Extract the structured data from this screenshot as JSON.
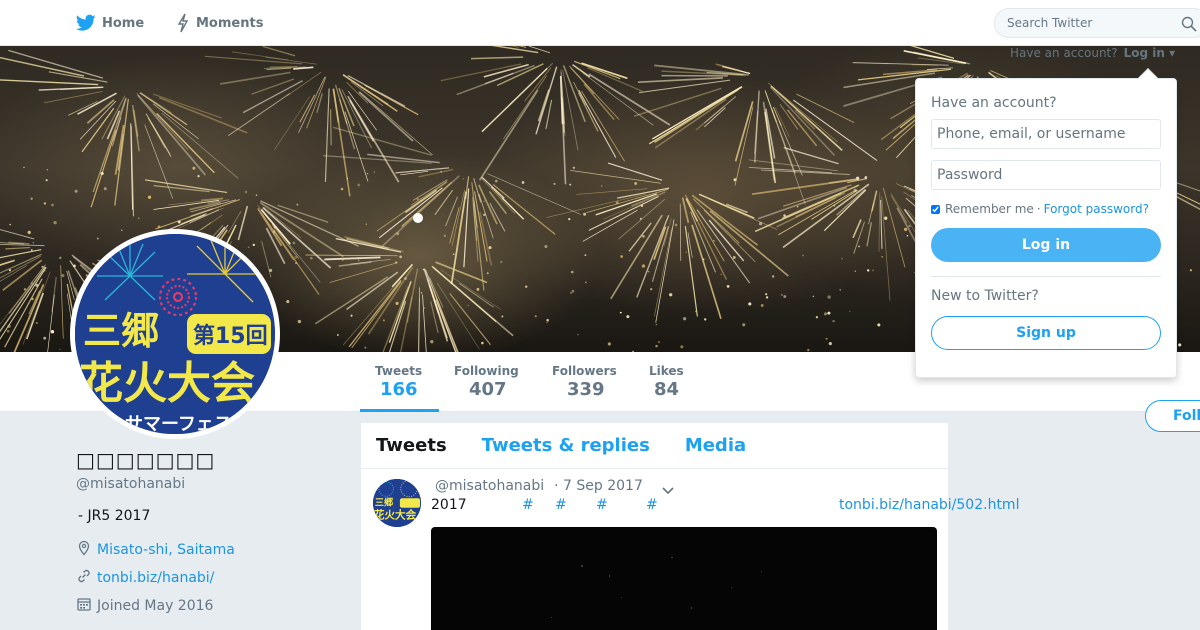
{
  "nav": {
    "home_label": "Home",
    "moments_label": "Moments",
    "search_placeholder": "Search Twitter"
  },
  "header_account": {
    "prompt": "Have an account?",
    "login_label": "Log in"
  },
  "stats": {
    "tweets_label": "Tweets",
    "tweets_value": "166",
    "following_label": "Following",
    "following_value": "407",
    "followers_label": "Followers",
    "followers_value": "339",
    "likes_label": "Likes",
    "likes_value": "84"
  },
  "follow_button_label": "Follow",
  "profile": {
    "name": "□□□□□□□",
    "handle": "@misatohanabi",
    "bio": "- JR5 2017",
    "location": "Misato-shi, Saitama",
    "url": "tonbi.biz/hanabi/",
    "joined": "Joined May 2016"
  },
  "avatar_art": {
    "line1": "三郷",
    "badge": "第15回",
    "line2": "花火大会",
    "line3": "サマーフェスティ"
  },
  "timeline": {
    "tabs": [
      "Tweets",
      "Tweets & replies",
      "Media"
    ],
    "tweet": {
      "handle": "@misatohanabi",
      "date": "· 7 Sep 2017",
      "text_year": "2017",
      "hashtags": [
        "#",
        "#",
        "#",
        "#"
      ],
      "link": "tonbi.biz/hanabi/502.html"
    }
  },
  "login_dropdown": {
    "title": "Have an account?",
    "username_placeholder": "Phone, email, or username",
    "password_placeholder": "Password",
    "remember_label": "Remember me",
    "separator": "·",
    "forgot_label": "Forgot password?",
    "login_button": "Log in",
    "new_prompt": "New to Twitter?",
    "signup_button": "Sign up"
  },
  "colors": {
    "accent": "#1da1f2",
    "link": "#1b95e0",
    "muted": "#657786",
    "page_bg": "#e6ecf0"
  }
}
